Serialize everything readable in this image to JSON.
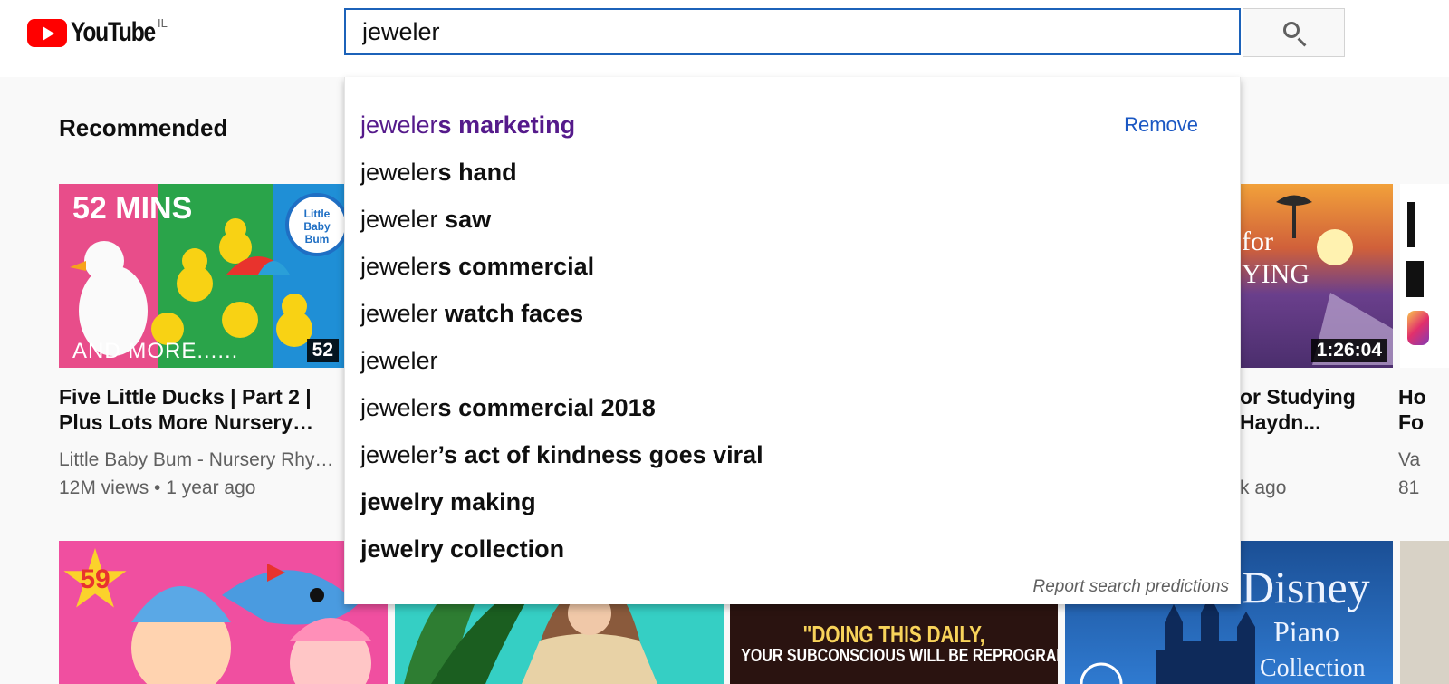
{
  "header": {
    "logo_text": "YouTube",
    "country_code": "IL",
    "search_value": "jeweler",
    "search_button_icon": "search-icon"
  },
  "main": {
    "section_title": "Recommended",
    "videos_row1": [
      {
        "thumb_text_top": "52 MINS",
        "thumb_text_bottom": "AND MORE......",
        "badge": "Little Baby Bum",
        "duration": "52",
        "title": "Five Little Ducks | Part 2 | Plus Lots More Nursery…",
        "channel": "Little Baby Bum - Nursery Rhy…",
        "views": "12M views",
        "age": "1 year ago"
      },
      {
        "thumb_text": "for YING",
        "duration": "1:26:04",
        "title_fragment_1": "or Studying",
        "title_fragment_2": "Haydn...",
        "meta_fragment": "k ago"
      },
      {
        "title_fragment_1": "Ho",
        "title_fragment_2": "Fo",
        "channel_fragment": "Va",
        "meta_fragment": "81"
      }
    ],
    "videos_row2": [
      {
        "badge": "59"
      },
      {
        "caption_line1": "\"DOING THIS DAILY,",
        "caption_line2": "YOUR SUBCONSCIOUS WILL BE REPROGRAMED\""
      },
      {
        "title_line1": "Disney",
        "title_line2": "Piano",
        "title_line3": "Collection"
      }
    ]
  },
  "suggestions": {
    "remove_label": "Remove",
    "report_label": "Report search predictions",
    "items": [
      {
        "prefix": "jeweler",
        "suffix": "s marketing",
        "visited": true
      },
      {
        "prefix": "jeweler",
        "suffix": "s hand"
      },
      {
        "prefix": "jeweler",
        "suffix": " saw"
      },
      {
        "prefix": "jeweler",
        "suffix": "s commercial"
      },
      {
        "prefix": "jeweler",
        "suffix": " watch faces"
      },
      {
        "prefix": "jeweler",
        "suffix": ""
      },
      {
        "prefix": "jeweler",
        "suffix": "s commercial 2018"
      },
      {
        "prefix": "jeweler",
        "suffix": "’s act of kindness goes viral"
      },
      {
        "prefix": "",
        "suffix": "jewelry making"
      },
      {
        "prefix": "",
        "suffix": "jewelry collection"
      }
    ]
  },
  "colors": {
    "accent_blue": "#1c62b9",
    "link_blue": "#1a57c3",
    "visited_purple": "#551a8b",
    "brand_red": "#ff0000"
  }
}
